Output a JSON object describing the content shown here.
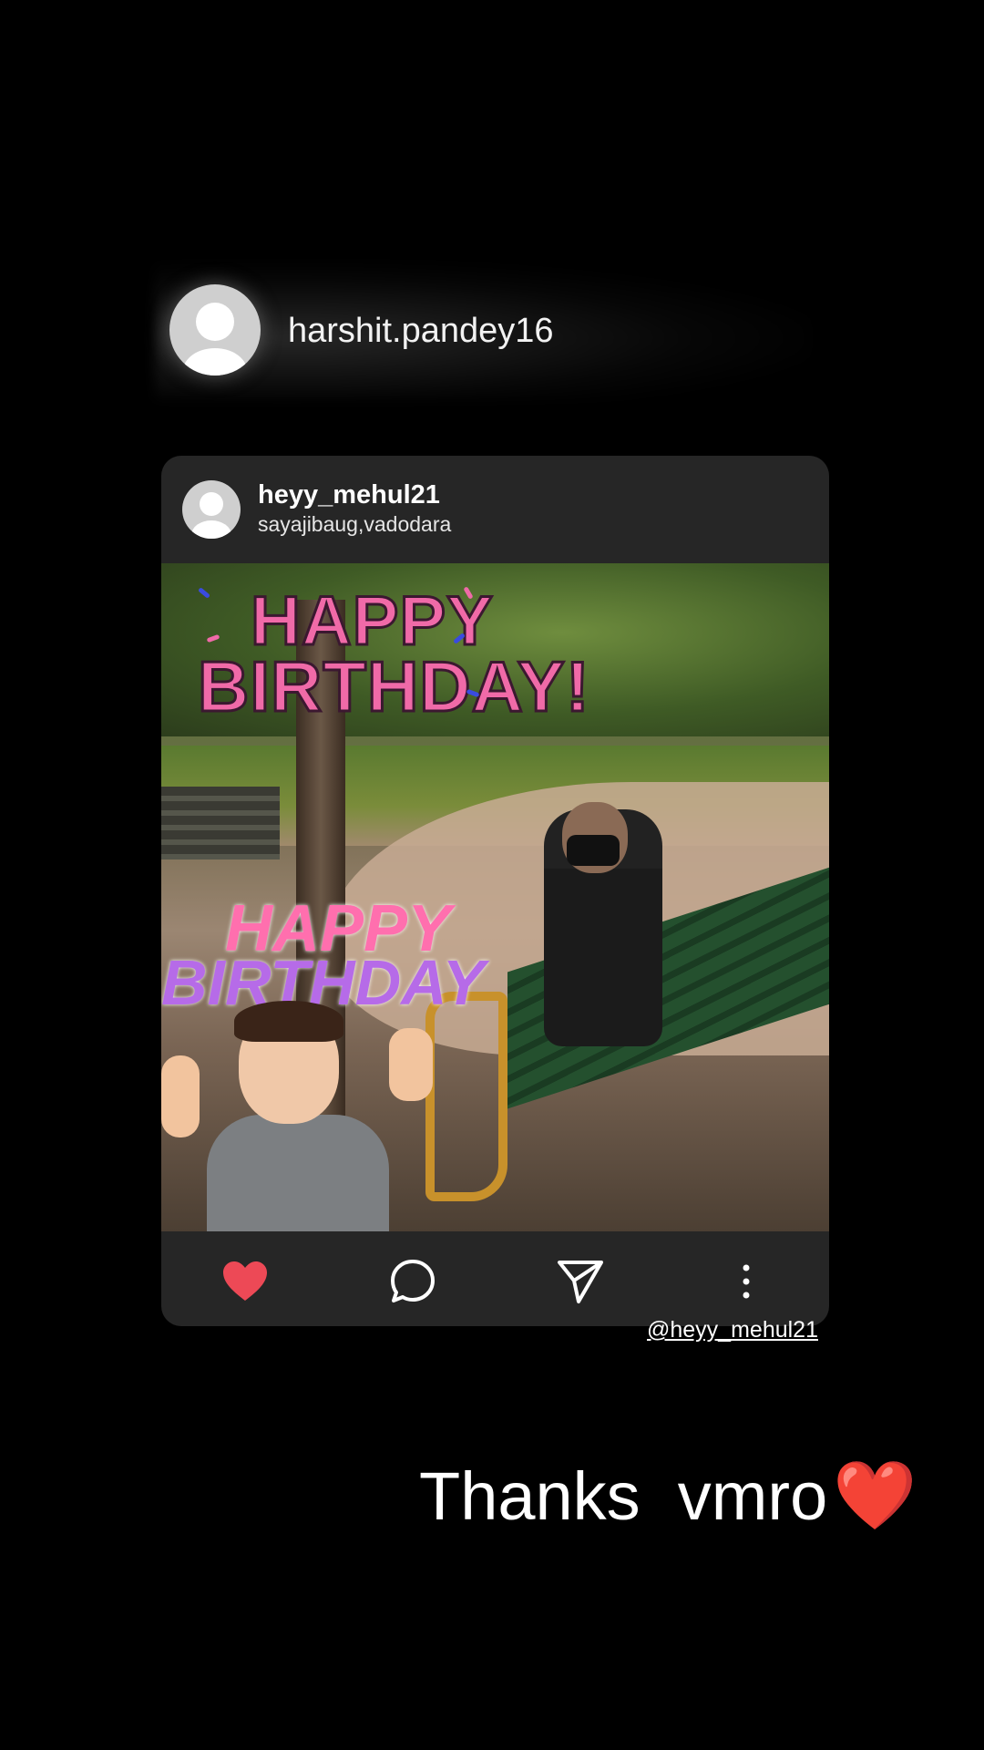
{
  "story": {
    "username": "harshit.pandey16"
  },
  "post": {
    "username": "heyy_mehul21",
    "location": "sayajibaug,vadodara",
    "stickers": {
      "happy_birthday_line1": "HAPPY",
      "happy_birthday_line2": "BIRTHDAY!",
      "balloon_line1": "HAPPY",
      "balloon_line2": "BIRTHDAY"
    },
    "actions": {
      "like": "heart-icon",
      "comment": "comment-icon",
      "share": "send-icon",
      "more": "more-vertical-icon",
      "like_color": "#ed4956"
    }
  },
  "mention": "@heyy_mehul21",
  "caption": {
    "text": "Thanks  vmro",
    "emoji": "❤️"
  }
}
